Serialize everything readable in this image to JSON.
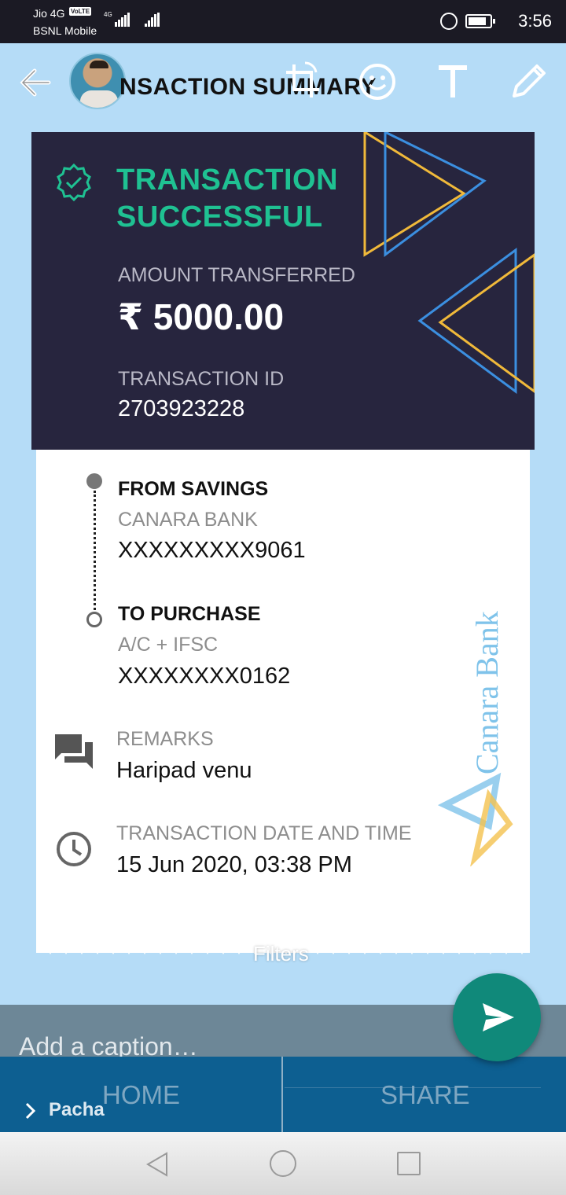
{
  "status_bar": {
    "carrier1": "Jio 4G",
    "volte": "VoLTE",
    "carrier2": "BSNL Mobile",
    "network": "4G",
    "time": "3:56"
  },
  "toolbar": {
    "title": "NSACTION SUMMARY",
    "icons": [
      "back-arrow-icon",
      "crop-rotate-icon",
      "emoji-icon",
      "text-icon",
      "pencil-icon"
    ]
  },
  "receipt": {
    "status": "TRANSACTION SUCCESSFUL",
    "status_line1": "TRANSACTION",
    "status_line2": "SUCCESSFUL",
    "amount_label": "AMOUNT TRANSFERRED",
    "amount": "₹ 5000.00",
    "txn_id_label": "TRANSACTION ID",
    "txn_id": "2703923228",
    "from_label": "FROM SAVINGS",
    "from_bank": "CANARA BANK",
    "from_account": "XXXXXXXXX9061",
    "to_label": "TO PURCHASE",
    "to_type": "A/C + IFSC",
    "to_account": "XXXXXXXX0162",
    "remarks_label": "REMARKS",
    "remarks": "Haripad venu",
    "datetime_label": "TRANSACTION DATE AND TIME",
    "datetime": "15 Jun 2020, 03:38 PM",
    "watermark": "Canara Bank"
  },
  "colors": {
    "success": "#1fc192",
    "card_dark": "#27253e",
    "accent_blue": "#3b8fe0",
    "accent_yellow": "#f0b93a",
    "send_button": "#10897a",
    "bottom_nav": "#0d5f91"
  },
  "editor": {
    "filters_label": "Filters",
    "caption_placeholder": "Add a caption…",
    "recipient": "Pacha"
  },
  "bottom_nav": {
    "home": "HOME",
    "share": "SHARE"
  }
}
